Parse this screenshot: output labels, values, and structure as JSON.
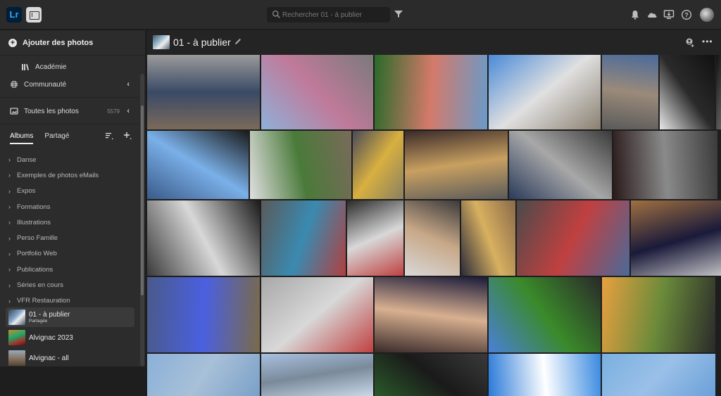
{
  "topbar": {
    "logo": "Lr",
    "search_placeholder": "Rechercher 01 - à publier",
    "icons": [
      "bell-icon",
      "cloud-icon",
      "display-download-icon",
      "help-icon",
      "avatar"
    ]
  },
  "sidebar": {
    "add_photos": "Ajouter des photos",
    "academie": "Académie",
    "communaute": "Communauté",
    "all_photos": "Toutes les photos",
    "all_photos_count": "5579",
    "tabs": [
      {
        "label": "Albums",
        "active": true
      },
      {
        "label": "Partagé",
        "active": false
      }
    ],
    "albums": [
      "Danse",
      "Exemples de photos eMails",
      "Expos",
      "Formations",
      "Illustrations",
      "Perso Famille",
      "Portfolio Web",
      "Publications",
      "Séries en cours",
      "VFR Restauration"
    ],
    "shared_albums": [
      {
        "name": "01 - à publier",
        "sub": "Partagée",
        "active": true
      },
      {
        "name": "Alvignac 2023",
        "sub": "",
        "active": false
      },
      {
        "name": "Alvignac - all",
        "sub": "",
        "active": false
      }
    ]
  },
  "main": {
    "title": "01 - à publier",
    "rows": [
      {
        "photos": [
          {
            "desc": "Street market, people in jeans",
            "colors": [
              "#7a6a5a",
              "#3a4a66",
              "#9a9a9a"
            ]
          },
          {
            "desc": "Two women posing at outdoor fair",
            "colors": [
              "#8fb0d8",
              "#c07a9a",
              "#7a7a7a"
            ]
          },
          {
            "desc": "Painted mural building",
            "colors": [
              "#2a6a2a",
              "#d47a6a",
              "#6a9ac8"
            ]
          },
          {
            "desc": "High-rise apartment building",
            "colors": [
              "#4a8ad8",
              "#e0e0e0",
              "#8a8070"
            ]
          },
          {
            "desc": "Building with mural of cat",
            "colors": [
              "#5a5a5a",
              "#9a8a7a",
              "#4a6a9a"
            ]
          },
          {
            "desc": "Black & white corridor",
            "colors": [
              "#e8e8e8",
              "#2a2a2a",
              "#111111"
            ]
          },
          {
            "desc": "Black & white skyscrapers",
            "colors": [
              "#111111",
              "#9a9a9a",
              "#444444"
            ]
          }
        ]
      },
      {
        "photos": [
          {
            "desc": "Staircase silhouette",
            "colors": [
              "#3a5a8a",
              "#7ab0e8",
              "#1a1a1a"
            ]
          },
          {
            "desc": "People sitting on wall",
            "colors": [
              "#e0e0e0",
              "#4a7a3a",
              "#7a6a5a"
            ]
          },
          {
            "desc": "Lighthouse and umbrella",
            "colors": [
              "#4a4a5a",
              "#d8b040",
              "#8a8060"
            ]
          },
          {
            "desc": "Night building facade",
            "colors": [
              "#3a2a2a",
              "#c8a060",
              "#5a5a5a"
            ]
          },
          {
            "desc": "Concrete bridge over water",
            "colors": [
              "#2a3a5a",
              "#a8a8a8",
              "#3a3a3a"
            ]
          },
          {
            "desc": "Man running by building",
            "colors": [
              "#2a1a1a",
              "#8a8a8a",
              "#3a3a3a"
            ]
          }
        ]
      },
      {
        "photos": [
          {
            "desc": "Bridge staircase",
            "colors": [
              "#3a3a3a",
              "#d8d8d8",
              "#1a1a1a"
            ]
          },
          {
            "desc": "Men eating street food",
            "colors": [
              "#5a5a5a",
              "#3a8ab0",
              "#b04040"
            ]
          },
          {
            "desc": "Hand with red nails poster",
            "colors": [
              "#2a2a2a",
              "#d8d8d8",
              "#c04040"
            ]
          },
          {
            "desc": "Man with hat walking",
            "colors": [
              "#d8d8d8",
              "#c8a888",
              "#3a3a3a"
            ]
          },
          {
            "desc": "Hat shop window",
            "colors": [
              "#2a2a3a",
              "#d8b060",
              "#8a6a4a"
            ]
          },
          {
            "desc": "Tourists at t-shirt shop",
            "colors": [
              "#4a4a4a",
              "#c04040",
              "#4a6a9a"
            ]
          },
          {
            "desc": "Woman and leopard poster",
            "colors": [
              "#a07040",
              "#1a1a3a",
              "#d8d8d8"
            ]
          }
        ]
      },
      {
        "photos": [
          {
            "desc": "Blue-lit entrance at night",
            "colors": [
              "#4a5a8a",
              "#4a60e0",
              "#7a6a4a"
            ]
          },
          {
            "desc": "T2 terminal walkers",
            "colors": [
              "#a8a8a8",
              "#d8d8d8",
              "#c04040"
            ]
          },
          {
            "desc": "Shop with big hat",
            "colors": [
              "#3a2a2a",
              "#d8b090",
              "#1a1a3a"
            ]
          },
          {
            "desc": "Motorcycle in field",
            "colors": [
              "#4a80d8",
              "#3a8a2a",
              "#2a2a2a"
            ]
          },
          {
            "desc": "Motorcycle at sunset",
            "colors": [
              "#e8a040",
              "#6a8a3a",
              "#2a2a2a"
            ]
          }
        ]
      },
      {
        "photos": [
          {
            "desc": "Sky",
            "colors": [
              "#8ab0d8",
              "#a8c0d8",
              "#7aa0c8"
            ]
          },
          {
            "desc": "Trees and sky",
            "colors": [
              "#a8c0e0",
              "#7a8a9a",
              "#c8d8e8"
            ]
          },
          {
            "desc": "Dark foliage",
            "colors": [
              "#2a5a2a",
              "#1a1a1a",
              "#3a3a3a"
            ]
          },
          {
            "desc": "Blue sky with clouds",
            "colors": [
              "#2a7ad8",
              "#ffffff",
              "#3a8ae0"
            ]
          },
          {
            "desc": "Pale blue sky",
            "colors": [
              "#7ab0e0",
              "#9ac0e8",
              "#6aa0d8"
            ]
          }
        ]
      }
    ]
  }
}
